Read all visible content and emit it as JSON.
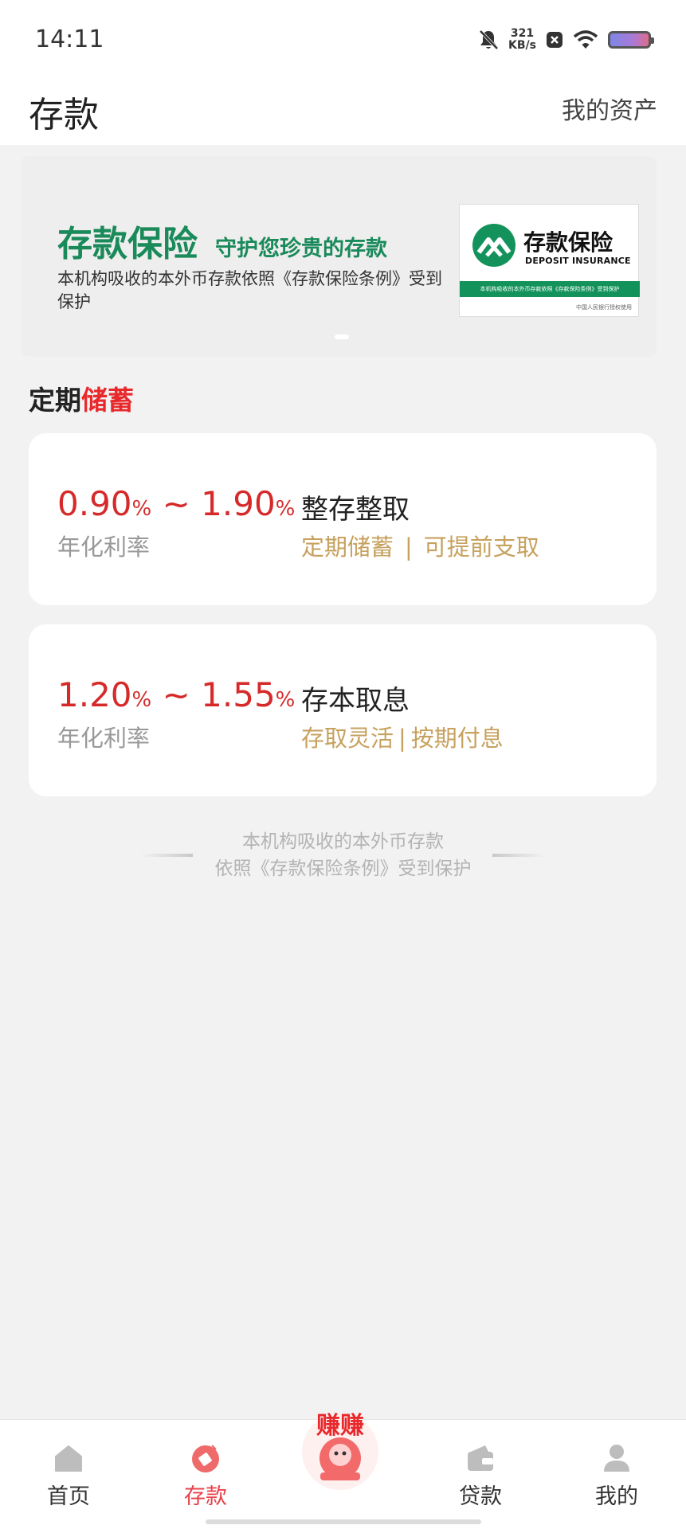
{
  "status_bar": {
    "time": "14:11",
    "net_speed_value": "321",
    "net_speed_unit": "KB/s",
    "icons": [
      "mute-icon",
      "close-box-icon",
      "wifi-icon",
      "battery-icon"
    ]
  },
  "header": {
    "title": "存款",
    "assets_link": "我的资产"
  },
  "banner": {
    "title": "存款保险",
    "subtitle": "守护您珍贵的存款",
    "description": "本机构吸收的本外币存款依照《存款保险条例》受到保护",
    "logo_cn": "存款保险",
    "logo_en": "DEPOSIT INSURANCE",
    "logo_strip": "本机构吸收的本外币存款依照《存款保险条例》受到保护",
    "logo_footer": "中国人民银行授权使用"
  },
  "section": {
    "title_a": "定期",
    "title_b": "储蓄",
    "accent_color": "#e8282b"
  },
  "products": [
    {
      "rate_min": "0.90",
      "rate_max": "1.90",
      "pct": "%",
      "tilde": "~",
      "rate_label": "年化利率",
      "name": "整存整取",
      "tag1": "定期储蓄",
      "tag2": "可提前支取",
      "sep": "|"
    },
    {
      "rate_min": "1.20",
      "rate_max": "1.55",
      "pct": "%",
      "tilde": "~",
      "rate_label": "年化利率",
      "name": "存本取息",
      "tag1": "存取灵活",
      "tag2": "按期付息",
      "sep": "|"
    }
  ],
  "note": {
    "line1": "本机构吸收的本外币存款",
    "line2": "依照《存款保险条例》受到保护"
  },
  "bottom_nav": {
    "items": [
      {
        "label": "首页",
        "icon": "home-icon"
      },
      {
        "label": "存款",
        "icon": "deposit-icon",
        "active": true
      },
      {
        "label": "贷款",
        "icon": "wallet-icon"
      },
      {
        "label": "我的",
        "icon": "user-icon"
      }
    ],
    "earn_badge": "赚赚",
    "active_color": "#e8414a"
  }
}
